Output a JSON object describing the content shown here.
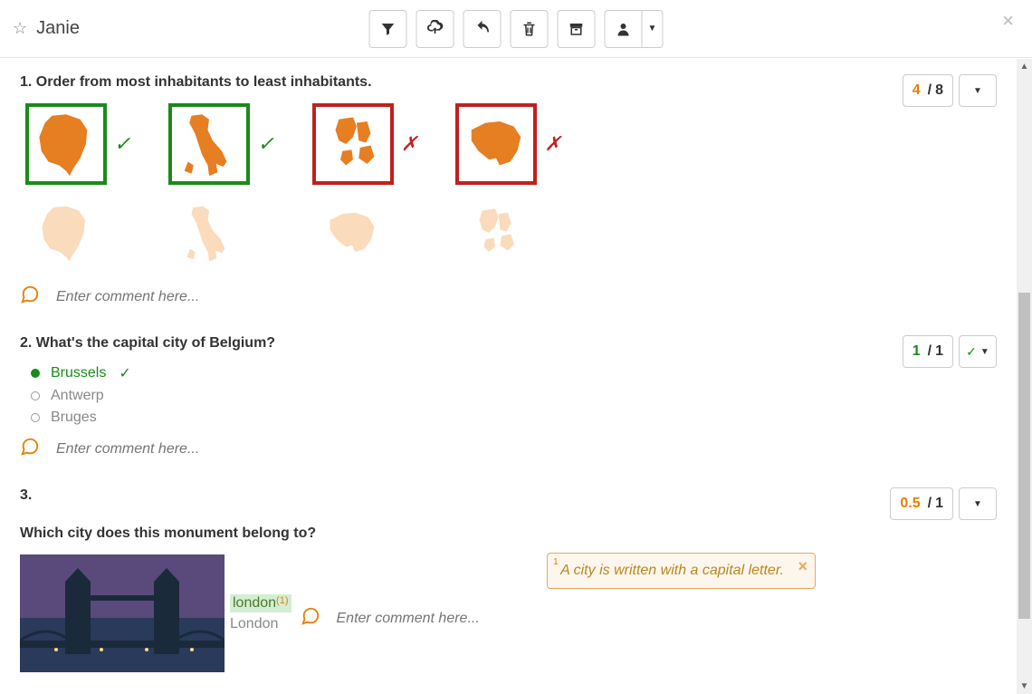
{
  "header": {
    "student_name": "Janie"
  },
  "toolbar": {
    "icons": [
      "filter",
      "cloud-download",
      "undo",
      "trash",
      "archive",
      "user"
    ]
  },
  "questions": {
    "q1": {
      "number": "1.",
      "title": "Order from most inhabitants to least inhabitants.",
      "score_earned": "4",
      "score_total": "8",
      "comment_placeholder": "Enter comment here..."
    },
    "q2": {
      "number": "2.",
      "title": "What's the capital city of Belgium?",
      "score_earned": "1",
      "score_total": "1",
      "options": [
        {
          "label": "Brussels",
          "selected": true,
          "correct": true
        },
        {
          "label": "Antwerp",
          "selected": false,
          "correct": false
        },
        {
          "label": "Bruges",
          "selected": false,
          "correct": false
        }
      ],
      "comment_placeholder": "Enter comment here..."
    },
    "q3": {
      "number": "3.",
      "title": "Which city does this monument belong to?",
      "score_earned": "0.5",
      "score_total": "1",
      "student_answer": "london",
      "student_answer_ref": "(1)",
      "correct_answer": "London",
      "comment_placeholder": "Enter comment here...",
      "annotation_num": "1",
      "annotation_text": "A city is written with a capital letter."
    }
  }
}
